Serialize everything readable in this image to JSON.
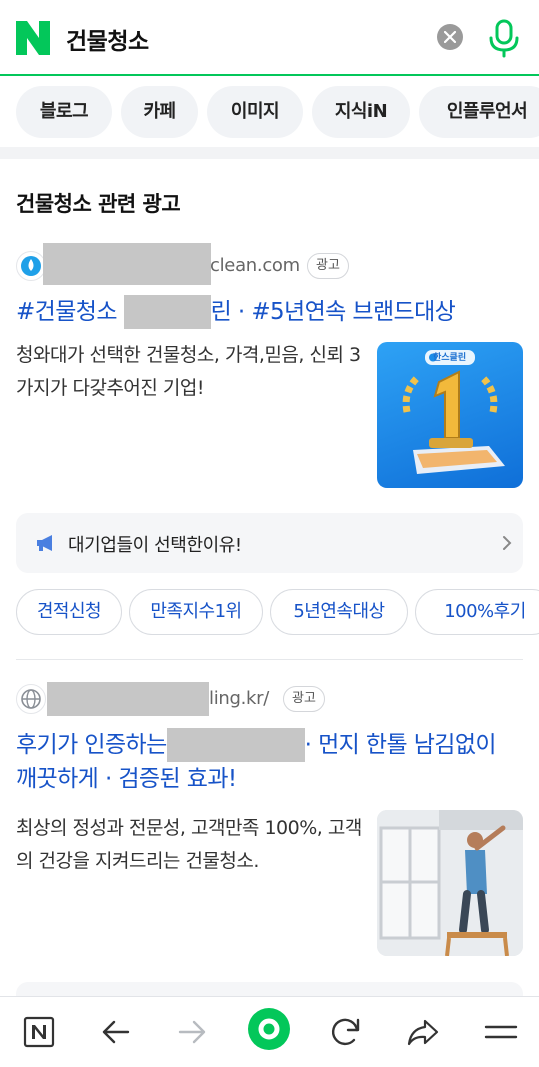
{
  "search": {
    "query": "건물청소",
    "logo_text": "N",
    "accent_color": "#03c75a"
  },
  "tabs": [
    {
      "label": "블로그"
    },
    {
      "label": "카페"
    },
    {
      "label": "이미지"
    },
    {
      "label": "지식iN"
    },
    {
      "label": "인플루언서"
    }
  ],
  "ads_section": {
    "title": "건물청소 관련 광고",
    "ads": [
      {
        "url_visible": "clean.com",
        "badge": "광고",
        "title_part1": "#건물청소",
        "title_part2": "린 · #5년연속 브랜드대상",
        "description": "청와대가 선택한 건물청소, 가격,믿음, 신뢰 3가지가 다갖추어진 기업!",
        "thumb_label": "한스클린",
        "promo_text": "대기업들이 선택한이유!",
        "chips": [
          "견적신청",
          "만족지수1위",
          "5년연속대상",
          "100%후기"
        ]
      },
      {
        "url_visible": "ling.kr/",
        "badge": "광고",
        "title_line1_part1": "후기가 인증하는",
        "title_line1_part2": "· 먼지 한톨 남김없이",
        "title_line2": "깨끗하게 · 검증된 효과!",
        "description": "최상의 정성과 전문성, 고객만족 100%, 고객의 건강을 지켜드리는 건물청소."
      }
    ]
  },
  "toolbar": {
    "icons": [
      "naver-home-icon",
      "back-arrow-icon",
      "forward-arrow-icon",
      "green-dot-icon",
      "refresh-icon",
      "share-icon",
      "menu-icon"
    ]
  }
}
